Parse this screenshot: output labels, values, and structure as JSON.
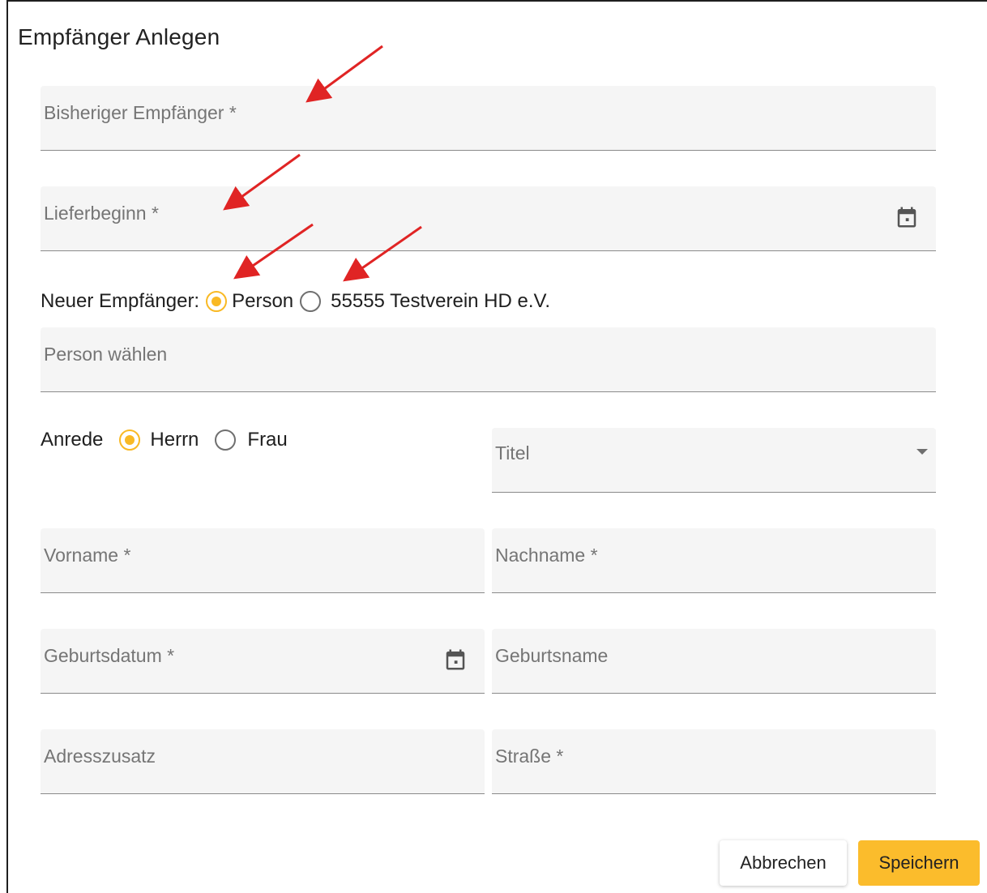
{
  "dialog": {
    "title": "Empfänger Anlegen"
  },
  "fields": {
    "bisheriger_empfaenger": "Bisheriger Empfänger *",
    "lieferbeginn": "Lieferbeginn *",
    "person_waehlen": "Person wählen",
    "titel": "Titel",
    "vorname": "Vorname *",
    "nachname": "Nachname *",
    "geburtsdatum": "Geburtsdatum *",
    "geburtsname": "Geburtsname",
    "adresszusatz": "Adresszusatz",
    "strasse": "Straße *"
  },
  "neuer_empfaenger": {
    "label": "Neuer Empfänger:",
    "options": [
      "Person",
      "55555 Testverein HD e.V."
    ],
    "selected": "Person"
  },
  "anrede": {
    "label": "Anrede",
    "options": [
      "Herrn",
      "Frau"
    ],
    "selected": "Herrn"
  },
  "buttons": {
    "cancel": "Abbrechen",
    "save": "Speichern"
  },
  "colors": {
    "accent": "#f9b924",
    "annotation_arrow": "#e02424",
    "field_bg": "#f5f5f5"
  },
  "icons": [
    "calendar-icon",
    "dropdown-arrow-icon"
  ]
}
